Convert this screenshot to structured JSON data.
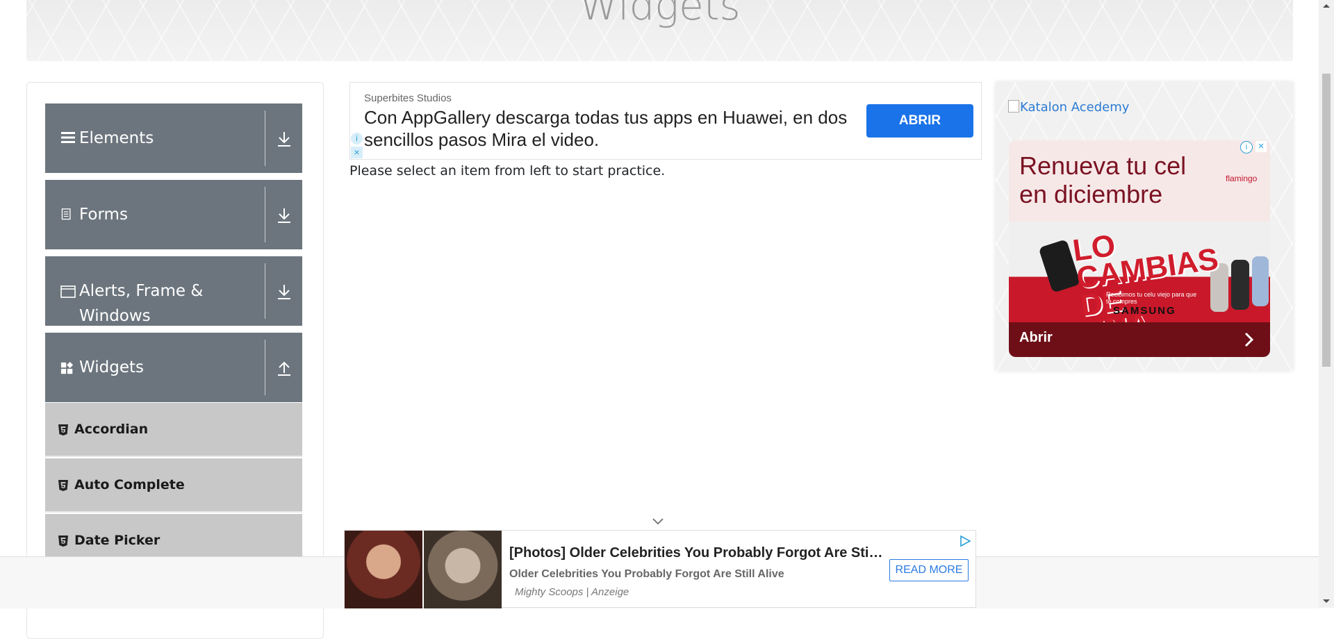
{
  "header": {
    "title": "Widgets"
  },
  "sidebar": {
    "groups": [
      {
        "label": "Elements",
        "icon": "hamburger-icon",
        "arrow": "download-arrow-icon"
      },
      {
        "label": "Forms",
        "icon": "document-icon",
        "arrow": "download-arrow-icon"
      },
      {
        "label": "Alerts, Frame & Windows",
        "icon": "window-icon",
        "arrow": "download-arrow-icon"
      },
      {
        "label": "Widgets",
        "icon": "widgets-icon",
        "arrow": "upload-arrow-icon"
      }
    ],
    "widget_items": [
      {
        "label": "Accordian",
        "icon": "html5-icon"
      },
      {
        "label": "Auto Complete",
        "icon": "html5-icon"
      },
      {
        "label": "Date Picker",
        "icon": "html5-icon"
      }
    ]
  },
  "top_ad": {
    "sponsor": "Superbites Studios",
    "headline": "Con AppGallery descarga todas tus apps en Huawei, en dos sencillos pasos Mira el video.",
    "button_label": "ABRIR",
    "button_color": "#1a73e8",
    "info_glyph": "i",
    "close_glyph": "×"
  },
  "main": {
    "instruction": "Please select an item from left to start practice."
  },
  "right_panel": {
    "link_text": "Katalon Acedemy",
    "promo": {
      "title": "Renueva tu cel en diciembre",
      "brand": "flamingo",
      "tagline": "LO CAMBIAS DE UNA",
      "small_text": "Recibimos tu celu viejo para que te compres",
      "samsung": "SAMSUNG",
      "open_label": "Abrir",
      "info_glyph": "i",
      "close_glyph": "×",
      "accent_color": "#7a1222"
    }
  },
  "bottom_ad": {
    "title": "[Photos] Older Celebrities You Probably Forgot Are Still Alive",
    "description": "Older Celebrities You Probably Forgot Are Still Alive",
    "source": "Mighty Scoops | Anzeige",
    "button_label": "READ MORE",
    "accent_color": "#2a7ae2"
  },
  "colors": {
    "menu_header_bg": "#6c757d",
    "menu_item_bg": "#c8c8c8",
    "link": "#2b7bd3"
  }
}
